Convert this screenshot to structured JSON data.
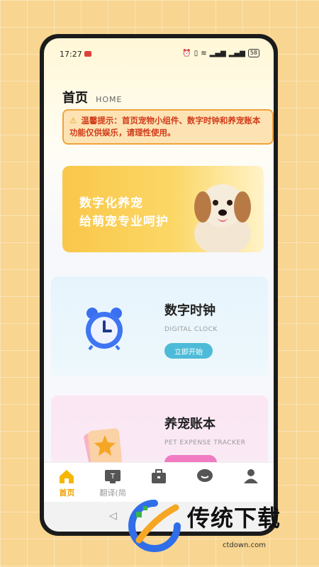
{
  "status": {
    "time": "17:27",
    "battery": "58"
  },
  "header": {
    "title": "首页",
    "subtitle": "HOME"
  },
  "notice": {
    "text": "温馨提示：首页宠物小组件、数字时钟和养宠账本功能仅供娱乐，请理性使用。"
  },
  "banner": {
    "line1": "数字化养宠",
    "line2": "给萌宠专业呵护"
  },
  "cards": {
    "clock": {
      "title": "数字时钟",
      "subtitle": "DIGITAL CLOCK",
      "button": "立即开始"
    },
    "expense": {
      "title": "养宠账本",
      "subtitle": "PET EXPENSE TRACKER"
    }
  },
  "tabs": [
    {
      "label": "首页",
      "icon": "home-icon"
    },
    {
      "label": "翻译(简",
      "icon": "translate-icon"
    },
    {
      "label": "",
      "icon": "toolbox-icon"
    },
    {
      "label": "",
      "icon": "chat-icon"
    },
    {
      "label": "",
      "icon": "profile-icon"
    }
  ],
  "watermark": {
    "text": "传统下载",
    "url": "ctdown.com"
  },
  "colors": {
    "accent": "#f0a000",
    "notice_text": "#d13b1a",
    "clock_button": "#4dbbd8",
    "expense_button": "#f07bc3"
  }
}
